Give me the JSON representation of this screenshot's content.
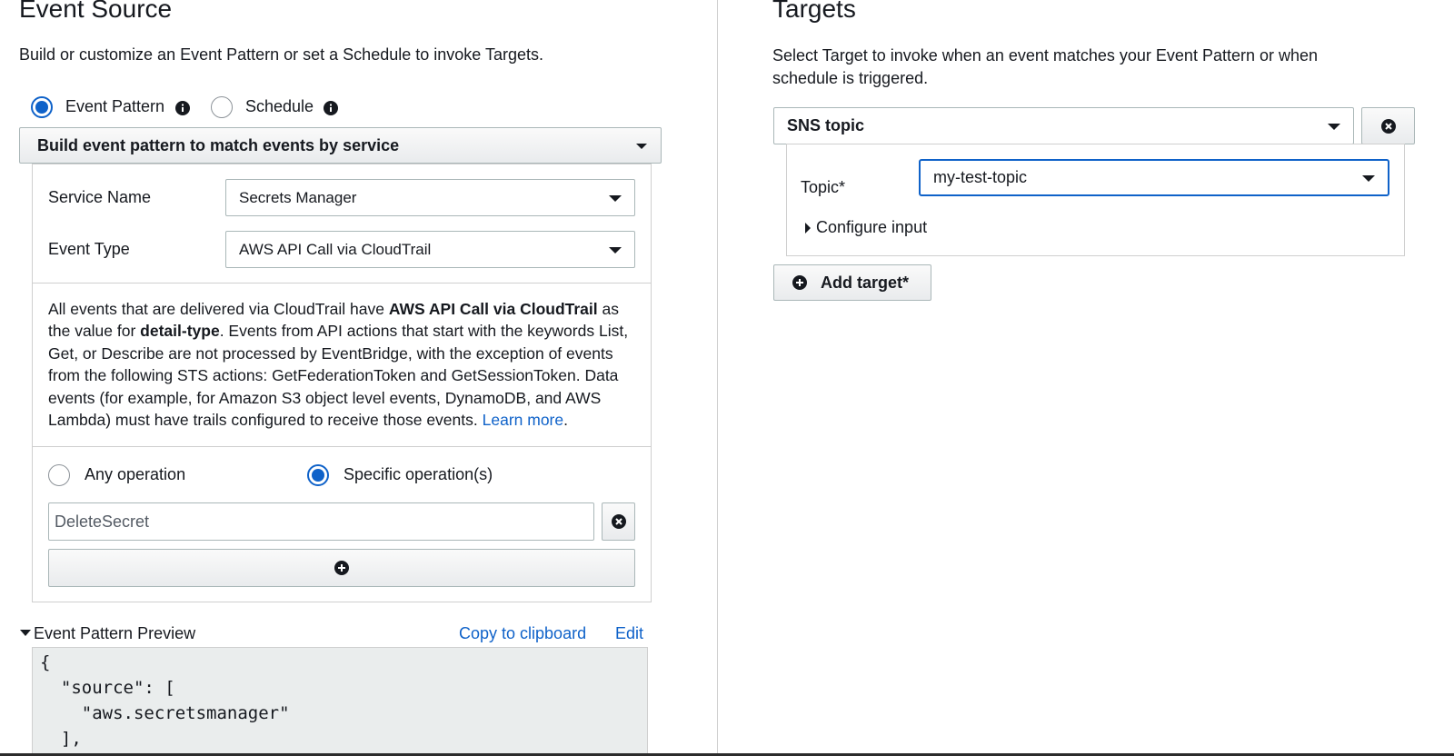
{
  "event_source": {
    "title": "Event Source",
    "description": "Build or customize an Event Pattern or set a Schedule to invoke Targets.",
    "mode_event_pattern": "Event Pattern",
    "mode_schedule": "Schedule",
    "pattern_builder": "Build event pattern to match events by service",
    "service_name_label": "Service Name",
    "service_name_value": "Secrets Manager",
    "event_type_label": "Event Type",
    "event_type_value": "AWS API Call via CloudTrail",
    "note": {
      "p1": "All events that are delivered via CloudTrail have ",
      "b1": "AWS API Call via CloudTrail",
      "p2": " as the value for ",
      "b2": "detail-type",
      "p3": ". Events from API actions that start with the keywords List, Get, or Describe are not processed by EventBridge, with the exception of events from the following STS actions: GetFederationToken and GetSessionToken. Data events (for example, for Amazon S3 object level events, DynamoDB, and AWS Lambda) must have trails configured to receive those events. ",
      "link": "Learn more",
      "p4": "."
    },
    "any_operation": "Any operation",
    "specific_operations": "Specific operation(s)",
    "operation_value": "DeleteSecret",
    "preview_title": "Event Pattern Preview",
    "copy_link": "Copy to clipboard",
    "edit_link": "Edit",
    "preview_code": "{\n  \"source\": [\n    \"aws.secretsmanager\"\n  ],"
  },
  "targets": {
    "title": "Targets",
    "description": "Select Target to invoke when an event matches your Event Pattern or when schedule is triggered.",
    "target_type": "SNS topic",
    "topic_label": "Topic*",
    "topic_value": "my-test-topic",
    "configure_input": "Configure input",
    "add_target": "Add target*"
  },
  "colors": {
    "accent": "#0f62c9",
    "text": "#16191f",
    "border": "#aab7b8"
  }
}
